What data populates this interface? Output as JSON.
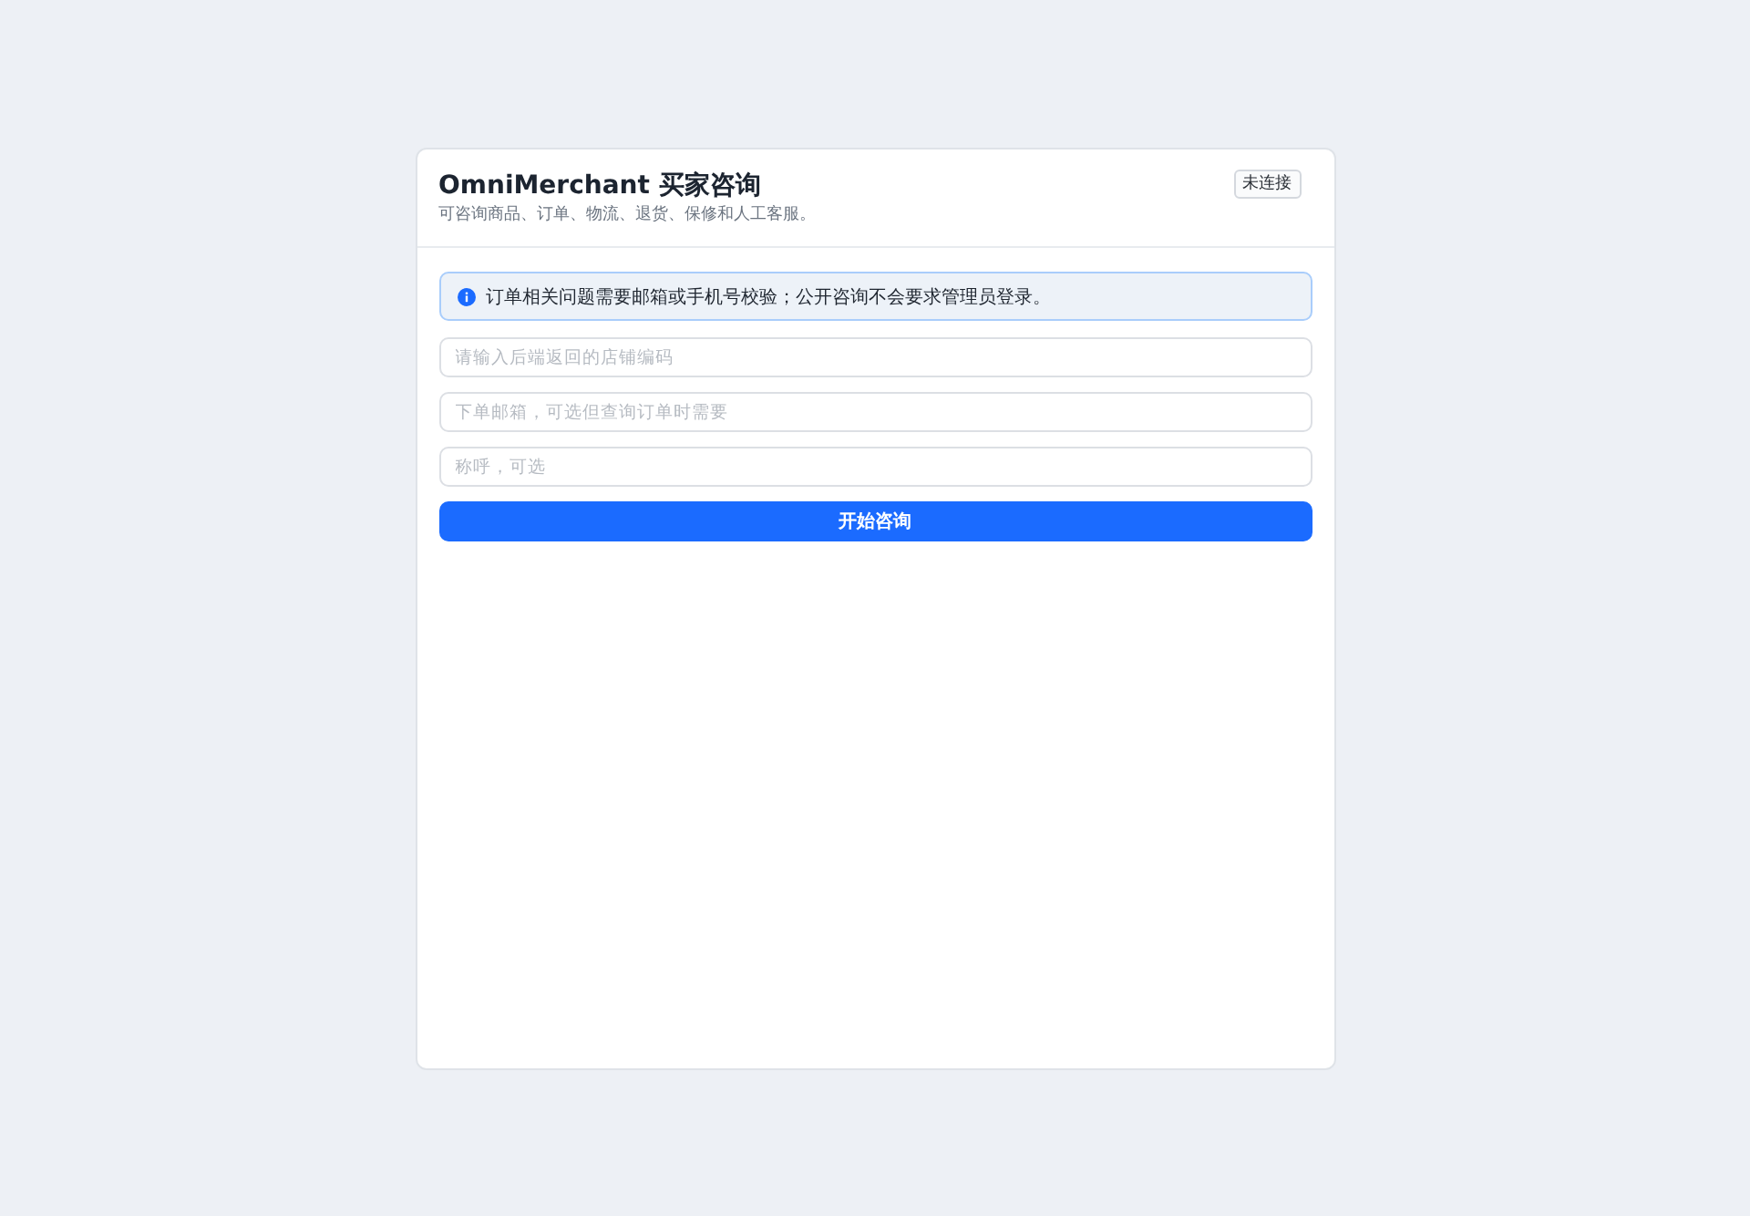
{
  "header": {
    "title": "OmniMerchant 买家咨询",
    "subtitle": "可咨询商品、订单、物流、退货、保修和人工客服。",
    "status": "未连接"
  },
  "notice": {
    "text": "订单相关问题需要邮箱或手机号校验；公开咨询不会要求管理员登录。"
  },
  "fields": [
    {
      "placeholder": "请输入后端返回的店铺编码"
    },
    {
      "placeholder": "下单邮箱，可选但查询订单时需要"
    },
    {
      "placeholder": "称呼，可选"
    }
  ],
  "submit_button": {
    "label": "开始咨询"
  }
}
